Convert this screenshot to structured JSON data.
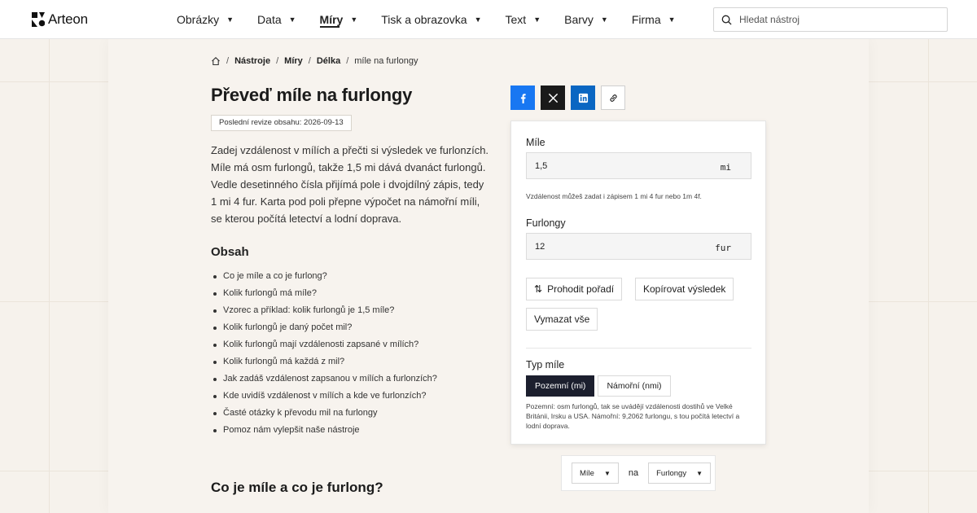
{
  "header": {
    "logo_text": "Arteon",
    "nav": [
      {
        "label": "Obrázky",
        "active": false
      },
      {
        "label": "Data",
        "active": false
      },
      {
        "label": "Míry",
        "active": true
      },
      {
        "label": "Tisk a obrazovka",
        "active": false
      },
      {
        "label": "Text",
        "active": false
      },
      {
        "label": "Barvy",
        "active": false
      },
      {
        "label": "Firma",
        "active": false
      }
    ],
    "search_placeholder": "Hledat nástroj"
  },
  "breadcrumb": {
    "items": [
      "Nástroje",
      "Míry",
      "Délka"
    ],
    "current": "míle na furlongy",
    "separator": "/"
  },
  "page": {
    "title": "Převeď míle na furlongy",
    "revision": "Poslední revize obsahu: 2026-09-13",
    "intro": "Zadej vzdálenost v mílích a přečti si výsledek ve furlonzích. Míle má osm furlongů, takže 1,5 mi dává dvanáct furlongů. Vedle desetinného čísla přijímá pole i dvojdílný zápis, tedy 1 mi 4 fur. Karta pod poli přepne výpočet na námořní míli, se kterou počítá letectví a lodní doprava.",
    "toc_title": "Obsah",
    "toc": [
      "Co je míle a co je furlong?",
      "Kolik furlongů má míle?",
      "Vzorec a příklad: kolik furlongů je 1,5 míle?",
      "Kolik furlongů je daný počet mil?",
      "Kolik furlongů mají vzdálenosti zapsané v mílích?",
      "Kolik furlongů má každá z mil?",
      "Jak zadáš vzdálenost zapsanou v mílích a furlonzích?",
      "Kde uvidíš vzdálenost v mílích a kde ve furlonzích?",
      "Časté otázky k převodu mil na furlongy",
      "Pomoz nám vylepšit naše nástroje"
    ],
    "section_title": "Co je míle a co je furlong?"
  },
  "share": {
    "buttons": [
      "facebook-icon",
      "x-icon",
      "linkedin-icon",
      "link-icon"
    ]
  },
  "converter": {
    "from_label": "Míle",
    "from_value": "1,5",
    "from_unit": "mi",
    "hint": "Vzdálenost můžeš zadat i zápisem 1 mi 4 fur nebo 1m 4f.",
    "to_label": "Furlongy",
    "to_value": "12",
    "to_unit": "fur",
    "swap_label": "Prohodit pořadí",
    "copy_label": "Kopírovat výsledek",
    "clear_label": "Vymazat vše",
    "mile_type_label": "Typ míle",
    "mile_types": [
      "Pozemní (mi)",
      "Námořní (nmi)"
    ],
    "mile_type_selected": "Pozemní (mi)",
    "mile_type_note": "Pozemní: osm furlongů, tak se uvádějí vzdálenosti dostihů ve Velké Británii, Irsku a USA. Námořní: 9,2062 furlongu, s tou počítá letectví a lodní doprava."
  },
  "unit_selector": {
    "from": "Míle",
    "connector": "na",
    "to": "Furlongy"
  },
  "colors": {
    "accent_dark": "#1c1f2e",
    "facebook": "#1877f2",
    "linkedin": "#0a66c2",
    "x": "#1a1a1a",
    "page_bg": "#f6f2ec"
  }
}
